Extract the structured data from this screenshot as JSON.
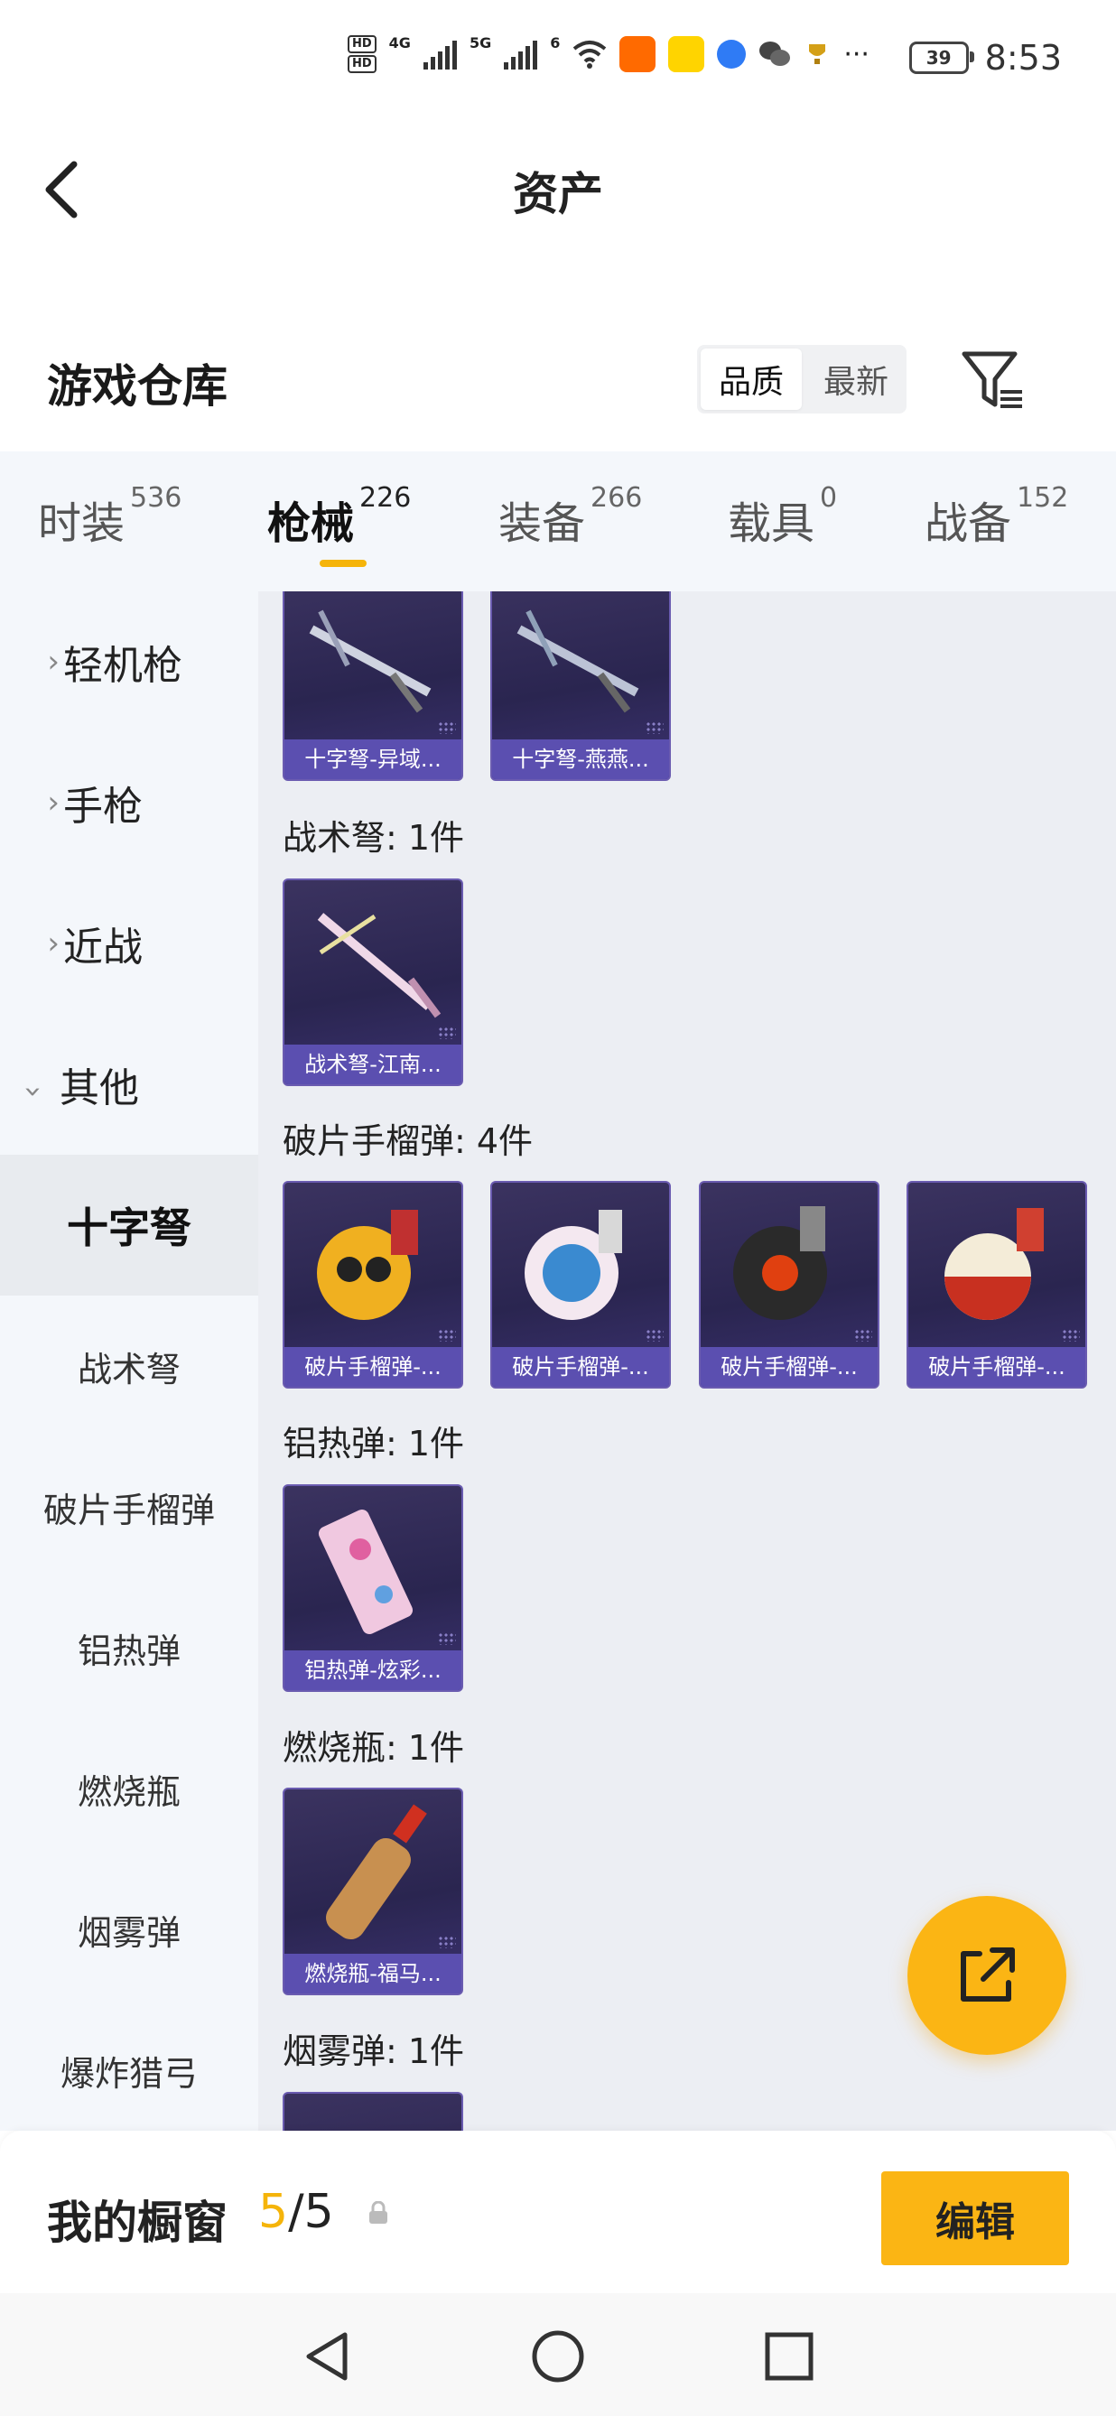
{
  "status_bar": {
    "time": "8:53",
    "battery": "39",
    "network_1": "4G",
    "network_2": "5G",
    "wifi_label": "6",
    "more": "···",
    "app_icons": [
      "taobao-icon",
      "app-icon",
      "browser-icon",
      "wechat-icon",
      "trophy-icon"
    ]
  },
  "header": {
    "title": "资产"
  },
  "section": {
    "title": "游戏仓库",
    "sort_options": [
      "品质",
      "最新"
    ],
    "active_sort": "品质"
  },
  "tabs": [
    {
      "label": "时装",
      "count": "536"
    },
    {
      "label": "枪械",
      "count": "226"
    },
    {
      "label": "装备",
      "count": "266"
    },
    {
      "label": "载具",
      "count": "0"
    },
    {
      "label": "战备",
      "count": "152"
    }
  ],
  "sidebar": {
    "categories": [
      {
        "label": "轻机枪",
        "expanded": false
      },
      {
        "label": "手枪",
        "expanded": false
      },
      {
        "label": "近战",
        "expanded": false
      },
      {
        "label": "其他",
        "expanded": true
      }
    ],
    "sub_items": [
      "十字弩",
      "战术弩",
      "破片手榴弹",
      "铝热弹",
      "燃烧瓶",
      "烟雾弹",
      "爆炸猎弓"
    ],
    "active_sub": "十字弩"
  },
  "groups": [
    {
      "title": "",
      "items": [
        "十字弩-异域...",
        "十字弩-燕燕..."
      ]
    },
    {
      "title": "战术弩: 1件",
      "items": [
        "战术弩-江南..."
      ]
    },
    {
      "title": "破片手榴弹: 4件",
      "items": [
        "破片手榴弹-...",
        "破片手榴弹-...",
        "破片手榴弹-...",
        "破片手榴弹-..."
      ]
    },
    {
      "title": "铝热弹: 1件",
      "items": [
        "铝热弹-炫彩..."
      ]
    },
    {
      "title": "燃烧瓶: 1件",
      "items": [
        "燃烧瓶-福马..."
      ]
    },
    {
      "title": "烟雾弹: 1件",
      "items": []
    }
  ],
  "bottom": {
    "label": "我的橱窗",
    "current": "5",
    "total": "/5",
    "edit": "编辑"
  },
  "colors": {
    "accent": "#fbb514",
    "card_bg": "#2a2550",
    "card_caption": "#5b4fb0"
  }
}
